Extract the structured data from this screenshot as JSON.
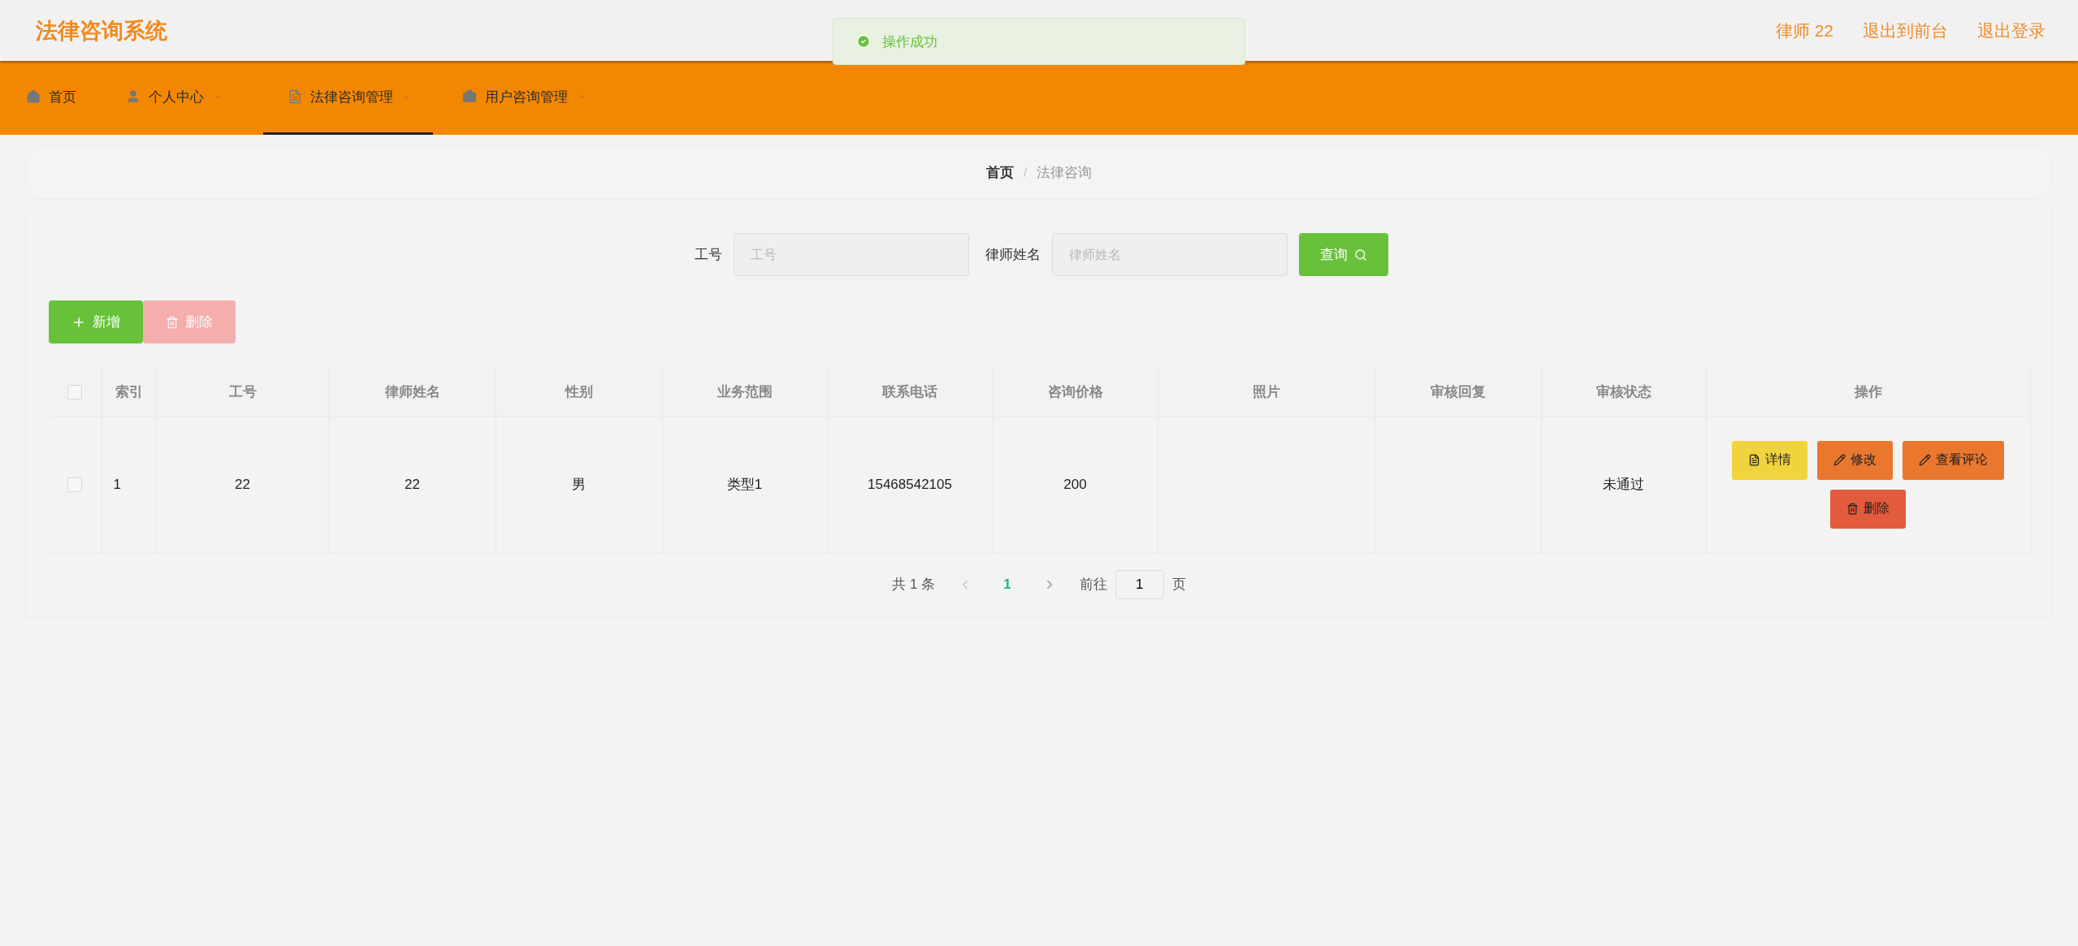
{
  "header": {
    "title": "法律咨询系统",
    "user_links": [
      {
        "label": "律师 22"
      },
      {
        "label": "退出到前台"
      },
      {
        "label": "退出登录"
      }
    ]
  },
  "toast": {
    "kind": "success",
    "message": "操作成功"
  },
  "nav": [
    {
      "label": "首页",
      "kind": "link",
      "selected": false
    },
    {
      "label": "个人中心",
      "kind": "menu",
      "selected": false
    },
    {
      "label": "法律咨询管理",
      "kind": "menu",
      "selected": true
    },
    {
      "label": "用户咨询管理",
      "kind": "menu",
      "selected": false
    }
  ],
  "breadcrumb": {
    "separator": "/",
    "items": [
      {
        "label": "首页"
      },
      {
        "label": "法律咨询"
      }
    ]
  },
  "search": {
    "fields": [
      {
        "label": "工号",
        "placeholder": "工号"
      },
      {
        "label": "律师姓名",
        "placeholder": "律师姓名"
      }
    ],
    "button": "查询"
  },
  "toolbar": [
    {
      "kind": "add",
      "label": "新增",
      "disabled": false
    },
    {
      "kind": "delete",
      "label": "删除",
      "disabled": true
    }
  ],
  "table": {
    "all_checked": false,
    "columns": [
      "索引",
      "工号",
      "律师姓名",
      "性别",
      "业务范围",
      "联系电话",
      "咨询价格",
      "照片",
      "审核回复",
      "审核状态",
      "操作"
    ],
    "rows": [
      {
        "checked": false,
        "cells": [
          "1",
          "22",
          "22",
          "男",
          "类型1",
          "15468542105",
          "200",
          "",
          "",
          "未通过"
        ],
        "actions": [
          {
            "kind": "detail",
            "label": "详情"
          },
          {
            "kind": "edit",
            "label": "修改"
          },
          {
            "kind": "edit",
            "label": "查看评论"
          },
          {
            "kind": "delete",
            "label": "删除"
          }
        ]
      }
    ]
  },
  "pagination": {
    "total": "共 1 条",
    "pages": [
      {
        "label": "1",
        "selected": true
      }
    ],
    "goto_label": "前往",
    "goto_value": "1",
    "page_suffix": "页"
  }
}
